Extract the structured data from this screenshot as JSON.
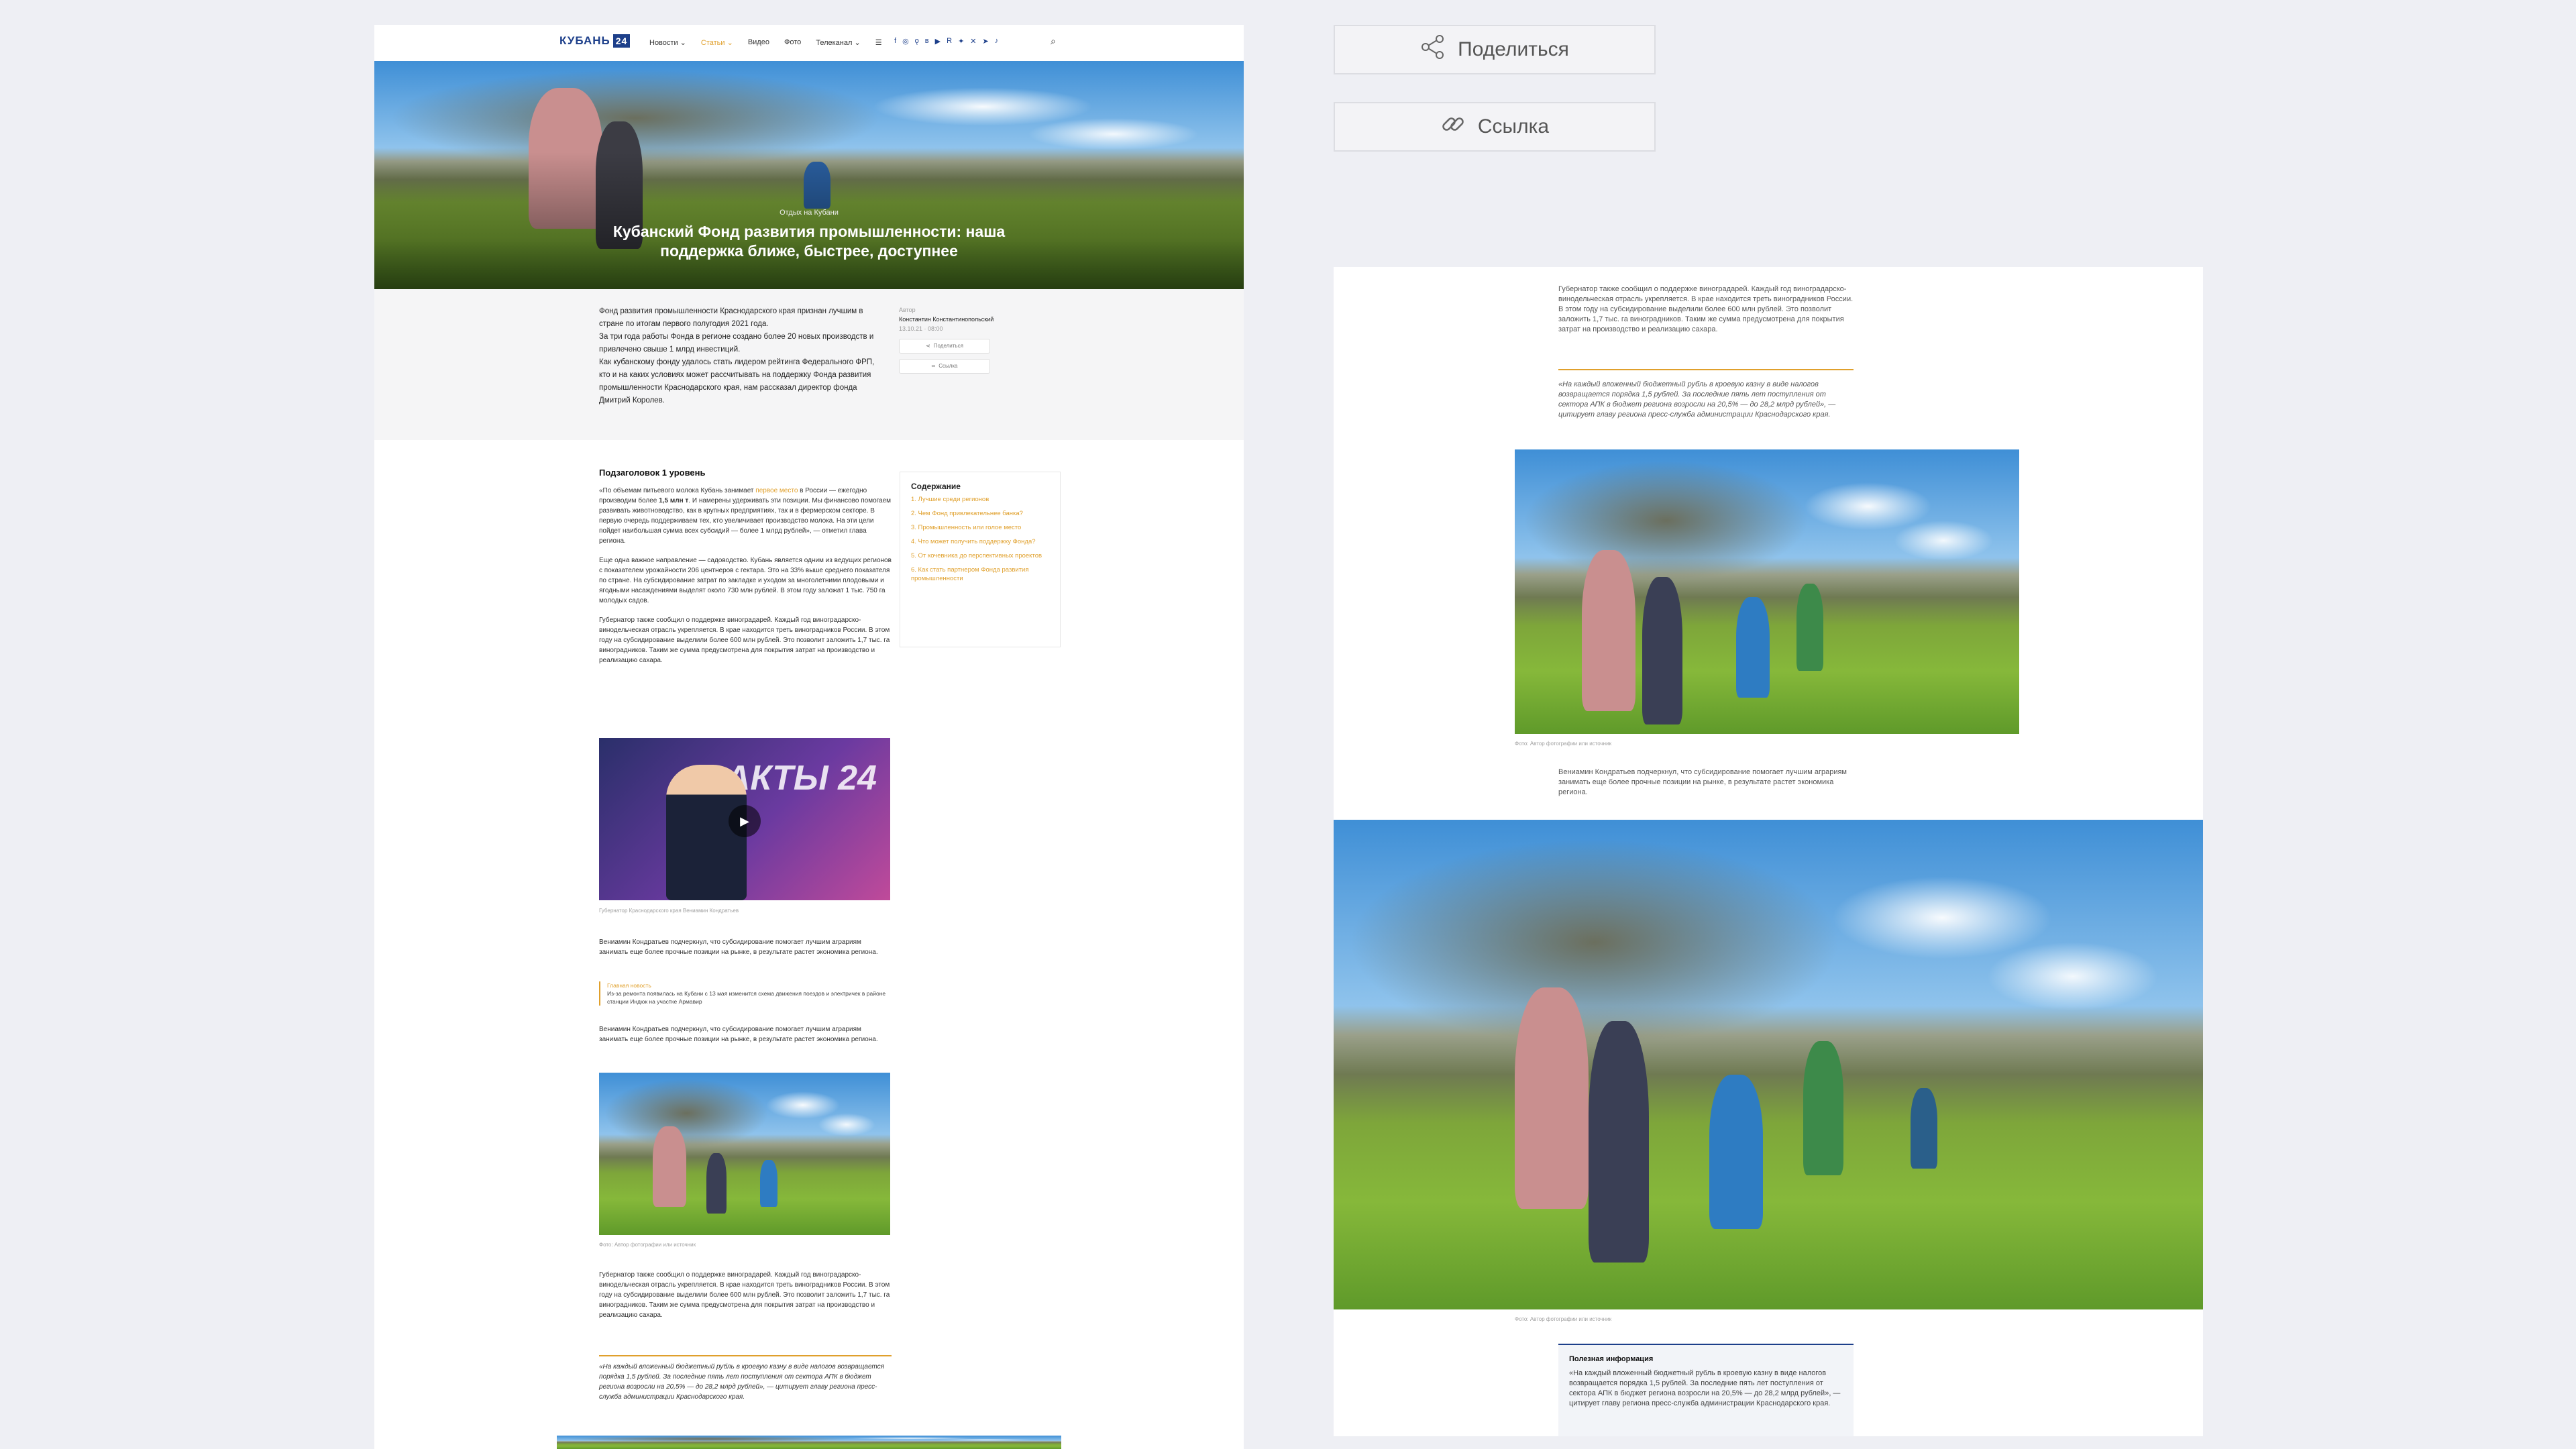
{
  "brand": {
    "logo_text": "КУБАНЬ",
    "logo_badge": "24",
    "brand_color": "#1d3f8a",
    "accent_color": "#e0a02c"
  },
  "nav": {
    "items": [
      "Новости",
      "Статьи",
      "Видео",
      "Фото",
      "Телеканал"
    ]
  },
  "social_icons": [
    "facebook-icon",
    "instagram-icon",
    "ok-icon",
    "vk-icon",
    "youtube-icon",
    "rutube-icon",
    "dzen-icon",
    "twitter-icon",
    "telegram-icon",
    "tiktok-icon"
  ],
  "hero": {
    "category": "Отдых на Кубани",
    "title": "Кубанский Фонд развития промышленности: наша поддержка ближе, быстрее, доступнее"
  },
  "lead": {
    "p1": "Фонд развития промышленности Краснодарского края признан лучшим в стране по итогам первого полугодия 2021 года.",
    "p2": "За три года работы Фонда в регионе создано более 20 новых производств и привлечено свыше 1 млрд инвестиций.",
    "p3": "Как кубанскому фонду удалось стать лидером рейтинга Федерального ФРП, кто и на каких условиях может рассчитывать на поддержку Фонда развития промышленности Краснодарского края, нам рассказал директор фонда Дмитрий Королев."
  },
  "meta": {
    "author_label": "Автор",
    "author": "Константин Константинопольский",
    "date": "13.10.21 · 08:00",
    "share_label": "Поделиться",
    "link_label": "Ссылка"
  },
  "article": {
    "h2": "Подзаголовок 1 уровень",
    "p1_a": "«По объемам питьевого молока Кубань занимает ",
    "p1_link": "первое место",
    "p1_b": " в России — ежегодно производим более ",
    "p1_bold": "1,5 млн т",
    "p1_c": ". И намерены удерживать эти позиции. Мы финансово помогаем развивать животноводство, как в крупных предприятиях, так и в фермерском секторе. В первую очередь поддерживаем тех, кто увеличивает производство молока. На эти цели пойдет наибольшая сумма всех субсидий — более 1 млрд рублей», — отметил глава региона.",
    "p2": "Еще одна важное направление — садоводство. Кубань является одним из ведущих регионов с показателем урожайности 206 центнеров с гектара. Это на 33% выше среднего показателя по стране. На субсидирование затрат по закладке и уходом за многолетними плодовыми и ягодными насаждениями выделят около 730 млн рублей. В этом году заложат 1 тыс. 750 га молодых садов.",
    "p3": "Губернатор также сообщил о поддержке виноградарей. Каждый год виноградарско-винодельческая отрасль укрепляется. В крае находится треть виноградников России. В этом году на субсидирование выделили более 600 млн рублей. Это позволит заложить 1,7 тыс. га виноградников. Таким же сумма предусмотрена для покрытия затрат на производство и реализацию сахара.",
    "video_logo": "ФАКТЫ 24",
    "video_caption": "Губернатор Краснодарского края Вениамин Кондратьев",
    "p4": "Вениамин Кондратьев подчеркнул, что субсидирование помогает лучшим аграриям занимать еще более прочные позиции на рынке, в результате растет экономика региона.",
    "quote_label": "Главная новость",
    "quote_text": "Из-за ремонта появилась на Кубани с 13 мая изменится схема движения поездов и электричек в районе станции Индюк на участке Армавир",
    "p5": "Вениамин Кондратьев подчеркнул, что субсидирование помогает лучшим аграриям занимать еще более прочные позиции на рынке, в результате растет экономика региона.",
    "photo_caption": "Фото: Автор фотографии или источник",
    "p6": "Губернатор также сообщил о поддержке виноградарей. Каждый год виноградарско-винодельческая отрасль укрепляется. В крае находится треть виноградников России. В этом году на субсидирование выделили более 600 млн рублей. Это позволит заложить 1,7 тыс. га виноградников. Таким же сумма предусмотрена для покрытия затрат на производство и реализацию сахара.",
    "quote2": "«На каждый вложенный бюджетный рубль в кроевую казну в виде налогов возвращается порядка 1,5 рублей. За последние пять лет поступления от сектора АПК в бюджет региона возросли на 20,5% — до 28,2 млрд рублей», — цитирует главу региона пресс-служба администрации Краснодарского края."
  },
  "toc": {
    "title": "Содержание",
    "items": [
      "1. Лучшие среди регионов",
      "2. Чем Фонд привлекательнее банка?",
      "3. Промышленность или голое место",
      "4. Что может получить поддержку Фонда?",
      "5. От кочевника до перспективных проектов",
      "6. Как стать партнером Фонда развития промышленности"
    ]
  },
  "right": {
    "share_label": "Поделиться",
    "link_label": "Ссылка",
    "text1": "Губернатор также сообщил о поддержке виноградарей. Каждый год виноградарско-винодельческая отрасль укрепляется. В крае находится треть виноградников России. В этом году на субсидирование выделили более 600 млн рублей. Это позволит заложить 1,7 тыс. га виноградников. Таким же сумма предусмотрена для покрытия затрат на производство и реализацию сахара.",
    "quote": "«На каждый вложенный бюджетный рубль в кроевую казну в виде налогов возвращается порядка 1,5 рублей. За последние пять лет поступления от сектора АПК в бюджет региона возросли на 20,5% — до 28,2 млрд рублей», — цитирует главу региона пресс-служба администрации Краснодарского края.",
    "photo_caption": "Фото: Автор фотографии или источник",
    "text2": "Вениамин Кондратьев подчеркнул, что субсидирование помогает лучшим аграриям занимать еще более прочные позиции на рынке, в результате растет экономика региона.",
    "photo_caption2": "Фото: Автор фотографии или источник",
    "info_title": "Полезная информация",
    "info_text": "«На каждый вложенный бюджетный рубль в кроевую казну в виде налогов возвращается порядка 1,5 рублей. За последние пять лет поступления от сектора АПК в бюджет региона возросли на 20,5% — до 28,2 млрд рублей», — цитирует главу региона пресс-служба администрации Краснодарского края."
  }
}
